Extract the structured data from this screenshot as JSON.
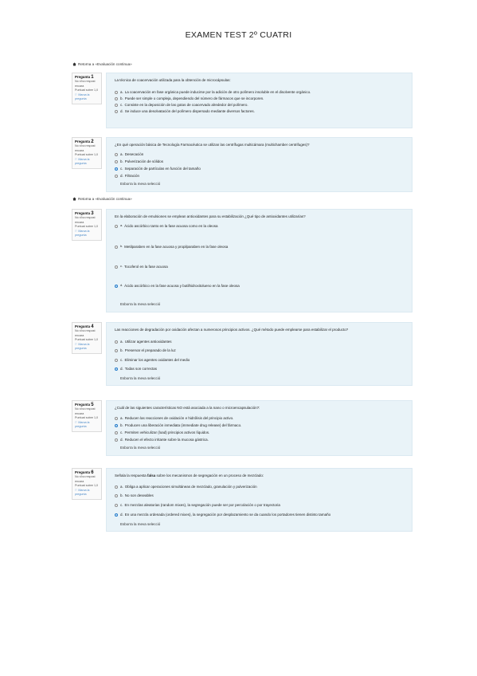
{
  "page": {
    "title": "EXAMEN TEST 2º CUATRI"
  },
  "back_links": [
    "Retorna a «Evaluación continua»",
    "Retorna a «Evaluación continua»"
  ],
  "questions": [
    {
      "label": "Pregunta",
      "num": "1",
      "status": "No s'ha respost encara",
      "score": "Puntuat sobre 1,0",
      "flag": "Marca la pregunta",
      "text": "La técnica de coacervación utilizada para la obtención de microcápsulas:",
      "options": [
        {
          "letter": "a.",
          "text": "La coacervación en fase orgánica puede inducirse por la adición de otro polímero insoluble en el disolvente orgánico.",
          "selected": false
        },
        {
          "letter": "b.",
          "text": "Puede ser simple o compleja, dependiendo del número de fármacos que se incorporen.",
          "selected": false
        },
        {
          "letter": "c.",
          "text": "Consiste en la deposición de las gotas de coacervado alrededor del polímero.",
          "selected": false
        },
        {
          "letter": "d.",
          "text": "Se induce una desolvatación del polímero dispersado mediante diversos factores.",
          "selected": false
        }
      ],
      "clear": ""
    },
    {
      "label": "Pregunta",
      "num": "2",
      "status": "No s'ha respost encara",
      "score": "Puntuat sobre 1,0",
      "flag": "Marca la pregunta",
      "text": "¿En qué operación básica de Tecnología Farmacéutica se utilizan las centrífugas multicámara (multichamber centrifuges)?",
      "options": [
        {
          "letter": "a.",
          "text": "Desecación",
          "selected": false
        },
        {
          "letter": "b.",
          "text": "Pulverización de sólidos",
          "selected": false
        },
        {
          "letter": "c.",
          "text": "Separación de partículas en función del tamaño",
          "selected": true
        },
        {
          "letter": "d.",
          "text": "Filtración",
          "selected": false
        }
      ],
      "clear": "Esborra la meva selecció"
    },
    {
      "label": "Pregunta",
      "num": "3",
      "status": "No s'ha respost encara",
      "score": "Puntuat sobre 1,0",
      "flag": "Marca la pregunta",
      "text": "En la elaboración de emulsiones se emplean antioxidantes para su estabilización ¿Qué tipo de antioxidantes utilizarías?",
      "options": [
        {
          "letter": "a.",
          "text": "Ácido ascórbico tanto en la fase acuosa como en la oleosa",
          "selected": false
        },
        {
          "letter": "b.",
          "text": "Metilparaben en la fase acuosa y propilparaben en la fase oleosa",
          "selected": false
        },
        {
          "letter": "c.",
          "text": "Tocoferol en la fase acuosa",
          "selected": false
        },
        {
          "letter": "d.",
          "text": "Ácido ascórbico en la fase acuosa y butilhidroxitolueno en la fase oleosa",
          "selected": true
        }
      ],
      "clear": "Esborra la meva selecció"
    },
    {
      "label": "Pregunta",
      "num": "4",
      "status": "No s'ha respost encara",
      "score": "Puntuat sobre 1,0",
      "flag": "Marca la pregunta",
      "text": "Las reacciones de degradación por oxidación afectan a numerosos principios activos. ¿Qué método puede emplearse para estabilizar el producto?",
      "options": [
        {
          "letter": "a.",
          "text": "Utilizar agentes antioxidantes",
          "selected": false
        },
        {
          "letter": "b.",
          "text": "Preservar el preparado de la luz",
          "selected": false
        },
        {
          "letter": "c.",
          "text": "Eliminar los agentes oxidantes del medio",
          "selected": false
        },
        {
          "letter": "d.",
          "text": "Todas son correctas",
          "selected": true
        }
      ],
      "clear": "Esborra la meva selecció"
    },
    {
      "label": "Pregunta",
      "num": "5",
      "status": "No s'ha respost encara",
      "score": "Puntuat sobre 1,0",
      "flag": "Marca la pregunta",
      "text": "¿Cuál de las siguientes características NO está asociada a la nano o microencapsulación?:",
      "options": [
        {
          "letter": "a.",
          "text": "Reducen las reacciones de oxidación e hidrólisis del principio activo.",
          "selected": false
        },
        {
          "letter": "b.",
          "text": "Producen una liberación inmediata (immediate drug release) del fármaco.",
          "selected": true
        },
        {
          "letter": "c.",
          "text": "Permiten vehiculizar (load) principios activos líquidos.",
          "selected": false
        },
        {
          "letter": "d.",
          "text": "Reducen el efecto irritante sobre la mucosa gástrica.",
          "selected": false
        }
      ],
      "clear": "Esborra la meva selecció"
    },
    {
      "label": "Pregunta",
      "num": "6",
      "status": "No s'ha respost encara",
      "score": "Puntuat sobre 1,0",
      "flag": "Marca la pregunta",
      "text_before": "Señala la respuesta ",
      "text_bold": "falsa",
      "text_after": " sobre los mecanismos de segregación en un proceso de mezclado:",
      "options": [
        {
          "letter": "a.",
          "text": "Obliga a aplicar operaciones simultáneas de mezclado, granulación y pulverización",
          "selected": false
        },
        {
          "letter": "b.",
          "text": "No son deseables",
          "selected": false
        },
        {
          "letter": "c.",
          "text": "En mezclas aleatorias (random mixes), la segregación puede ser por percolación o por trayectoria",
          "selected": false
        },
        {
          "letter": "d.",
          "text": "En una mezcla ordenada (ordered mixes), la segregación por desplazamiento se da cuando los portadores tienen distinto tamaño",
          "selected": true
        }
      ],
      "clear": "Esborra la meva selecció"
    }
  ]
}
